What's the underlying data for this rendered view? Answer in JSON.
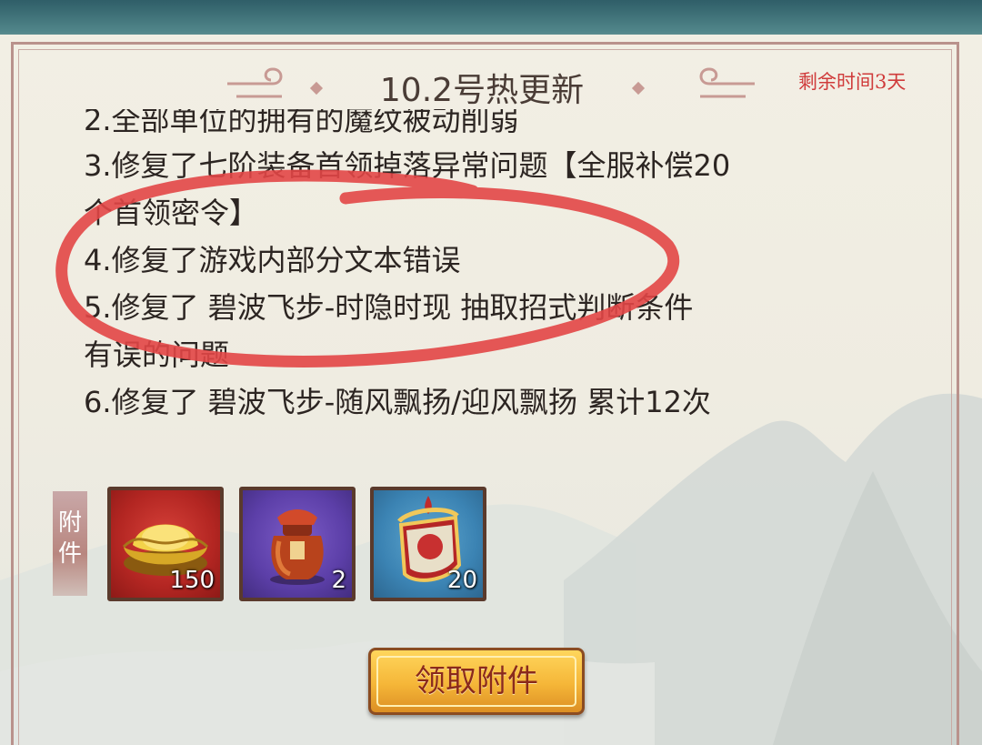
{
  "header": {
    "title": "10.2号热更新",
    "countdown": "剩余时间3天"
  },
  "notes": {
    "line_cut": "2.全部单位的拥有的魔纹被动削弱",
    "line_3a": "3.修复了七阶装备首领掉落异常问题【全服补偿20",
    "line_3b": "个首领密令】",
    "line_4": "4.修复了游戏内部分文本错误",
    "line_5a": "5.修复了  碧波飞步-时隐时现  抽取招式判断条件",
    "line_5b": "有误的问题",
    "line_6": "6.修复了  碧波飞步-随风飘扬/迎风飘扬  累计12次"
  },
  "attachments": {
    "label_top": "附",
    "label_bottom": "件",
    "items": [
      {
        "icon": "gold-ingot-icon",
        "count": "150",
        "color": "#b32622"
      },
      {
        "icon": "wine-jar-icon",
        "count": "2",
        "color": "#5c3fa8"
      },
      {
        "icon": "boss-token-icon",
        "count": "20",
        "color": "#3b83b3"
      }
    ]
  },
  "claim_button": {
    "label": "领取附件"
  },
  "colors": {
    "panel": "#f2efe4",
    "border": "#b9928c",
    "countdown": "#d03b3b",
    "annotation": "#e04848"
  }
}
